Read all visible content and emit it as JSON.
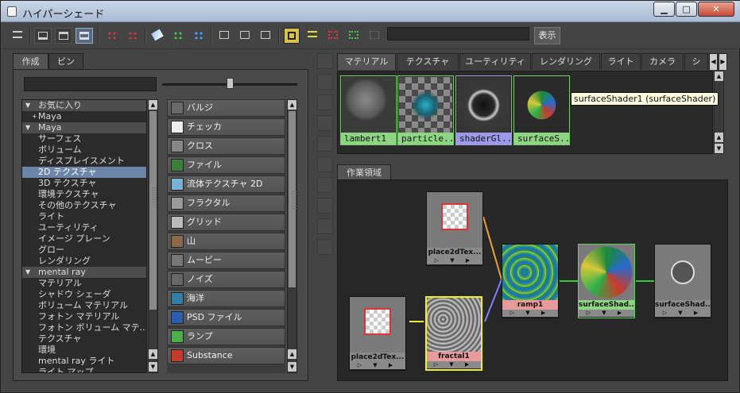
{
  "window": {
    "title": "ハイパーシェード",
    "min": "▁",
    "max": "□",
    "close": "✕"
  },
  "toolbar": {
    "show_label": "表示"
  },
  "left": {
    "tabs": [
      "作成",
      "ビン"
    ],
    "tree": [
      {
        "label": "お気に入り",
        "type": "hdr",
        "arrow": "▼"
      },
      {
        "label": "Maya",
        "type": "sub",
        "arrow": "+"
      },
      {
        "label": "Maya",
        "type": "hdr",
        "arrow": "▼"
      },
      {
        "label": "サーフェス"
      },
      {
        "label": "ボリューム"
      },
      {
        "label": "ディスプレイスメント"
      },
      {
        "label": "2D テクスチャ",
        "type": "sel"
      },
      {
        "label": "3D テクスチャ"
      },
      {
        "label": "環境テクスチャ"
      },
      {
        "label": "その他のテクスチャ"
      },
      {
        "label": "ライト"
      },
      {
        "label": "ユーティリティ"
      },
      {
        "label": "イメージ プレーン"
      },
      {
        "label": "グロー"
      },
      {
        "label": "レンダリング"
      },
      {
        "label": "mental ray",
        "type": "hdr",
        "arrow": "▼"
      },
      {
        "label": "マテリアル"
      },
      {
        "label": "シャドウ シェーダ"
      },
      {
        "label": "ボリューム マテリアル"
      },
      {
        "label": "フォトン マテリアル"
      },
      {
        "label": "フォトン ボリューム マテ..."
      },
      {
        "label": "テクスチャ"
      },
      {
        "label": "環境"
      },
      {
        "label": "mental ray ライト"
      },
      {
        "label": "ライト マップ"
      }
    ],
    "nodes": [
      {
        "label": "バルジ",
        "icon": "bulge-icon",
        "color": "#6a6a6a"
      },
      {
        "label": "チェッカ",
        "icon": "checker-icon",
        "color": "#eeeeee"
      },
      {
        "label": "クロス",
        "icon": "cloth-icon",
        "color": "#888888"
      },
      {
        "label": "ファイル",
        "icon": "file-icon",
        "color": "#3b7d3b"
      },
      {
        "label": "流体テクスチャ 2D",
        "icon": "fluid-texture-icon",
        "color": "#7ab0d8"
      },
      {
        "label": "フラクタル",
        "icon": "fractal-icon",
        "color": "#9a9a9a"
      },
      {
        "label": "グリッド",
        "icon": "grid-icon",
        "color": "#bbbbbb"
      },
      {
        "label": "山",
        "icon": "mountain-icon",
        "color": "#8a6a4a"
      },
      {
        "label": "ムービー",
        "icon": "movie-icon",
        "color": "#777777"
      },
      {
        "label": "ノイズ",
        "icon": "noise-icon",
        "color": "#666666"
      },
      {
        "label": "海洋",
        "icon": "ocean-icon",
        "color": "#2f7fa5"
      },
      {
        "label": "PSD ファイル",
        "icon": "psd-file-icon",
        "color": "#2a5fb0"
      },
      {
        "label": "ランプ",
        "icon": "ramp-icon",
        "color": "#4ab04a"
      },
      {
        "label": "Substance",
        "icon": "substance-icon",
        "color": "#c83a2a"
      }
    ]
  },
  "right": {
    "tabs": [
      "マテリアル",
      "テクスチャ",
      "ユーティリティ",
      "レンダリング",
      "ライト",
      "カメラ",
      "シ"
    ],
    "swatches": [
      {
        "label": "lambert1",
        "color": "#8ed583"
      },
      {
        "label": "particle...",
        "color": "#8ed583"
      },
      {
        "label": "shaderGl...",
        "color": "#9a9ae8"
      },
      {
        "label": "surfaceS...",
        "color": "#8ed583"
      }
    ],
    "tooltip": "surfaceShader1 (surfaceShader)",
    "work_tab": "作業領域",
    "graph_nodes": [
      {
        "id": "place2d_top",
        "label": "place2dTex..."
      },
      {
        "id": "place2d_bottom",
        "label": "place2dTex..."
      },
      {
        "id": "fractal1",
        "label": "fractal1"
      },
      {
        "id": "ramp1",
        "label": "ramp1"
      },
      {
        "id": "surface_shader",
        "label": "surfaceShad..."
      },
      {
        "id": "surface_sg",
        "label": "surfaceShad..."
      }
    ],
    "ports": "▷ ▼ ▶"
  }
}
